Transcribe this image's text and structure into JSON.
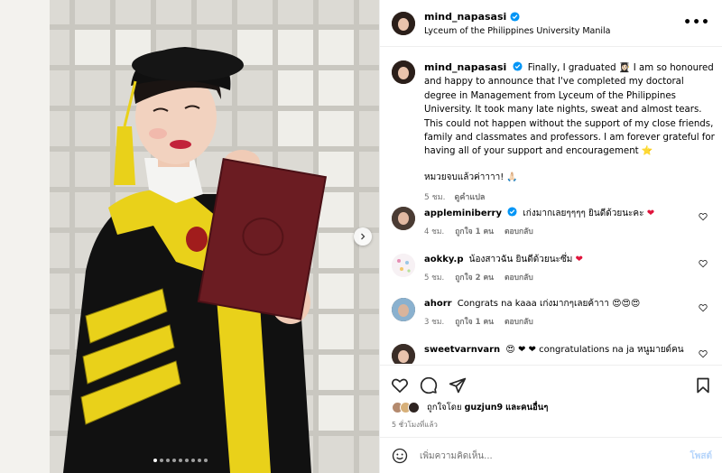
{
  "post": {
    "username": "mind_napasasi",
    "location": "Lyceum of the Philippines University Manila",
    "more_label": "•••"
  },
  "caption": {
    "username": "mind_napasasi",
    "text_a": "Finally, I graduated 👩🏻‍🎓 I am so honoured and happy to announce that I've completed my doctoral degree in Management from Lyceum of the Philippines University. It took many late nights, sweat and almost tears. This could not happen without the support of my close friends, family and classmates and professors. I am forever grateful for having all of your support and encouragement ⭐",
    "thai_line": "หมวยจบแล้วค่าาาา! 🙏🏻",
    "time": "5 ชม.",
    "translate": "ดูคำแปล"
  },
  "comments": [
    {
      "username": "appleminiberry",
      "text": "เก่งมากเลยๆๆๆๆ ยินดีด้วยนะคะ",
      "emoji": "❤",
      "time": "4 ชม.",
      "likes": "ถูกใจ 1 คน",
      "reply": "ตอบกลับ"
    },
    {
      "username": "aokky.p",
      "text": "น้องสาวฉัน ยินดีด้วยนะซึ่ม",
      "emoji": "❤",
      "time": "5 ชม.",
      "likes": "ถูกใจ 2 คน",
      "reply": "ตอบกลับ"
    },
    {
      "username": "ahorr",
      "text": "Congrats na kaaa เก่งมากๆเลยค้าาา",
      "emoji": "😍😍😍",
      "time": "3 ชม.",
      "likes": "ถูกใจ 1 คน",
      "reply": "ตอบกลับ"
    },
    {
      "username": "sweetvarnvarn",
      "text": "😍 ❤ ❤ congratulations na ja หนูมายด์คน",
      "emoji": "",
      "time": "",
      "likes": "",
      "reply": ""
    }
  ],
  "likes": {
    "prefix": "ถูกใจโดย",
    "user": "guzjun9",
    "suffix": "และคนอื่นๆ"
  },
  "time_posted": "5 ชั่วโมงที่แล้ว",
  "add_comment": {
    "placeholder": "เพิ่มความคิดเห็น...",
    "post_label": "โพสต์"
  },
  "colors": {
    "verified": "#0095f6",
    "heart": "#e0143c",
    "post_button": "#b6d5fb",
    "secondary_text": "#737373"
  },
  "carousel": {
    "total": 9,
    "current": 1
  }
}
